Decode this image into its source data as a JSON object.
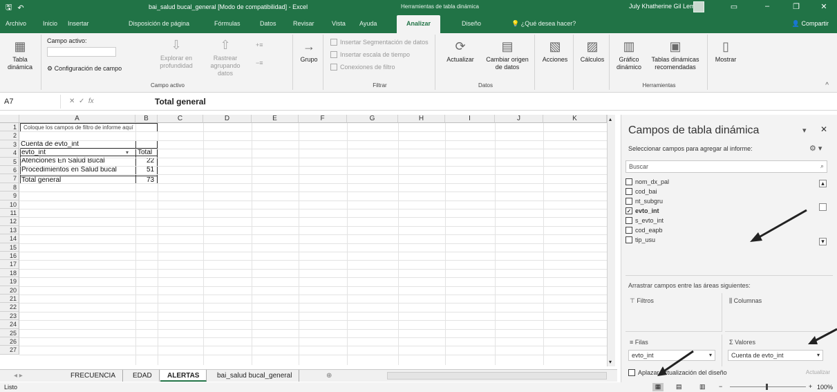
{
  "window": {
    "title": "bai_salud bucal_general  [Modo de compatibilidad]  -  Excel",
    "tools_label": "Herramientas de tabla dinámica",
    "user": "July Khatherine Gil Lemus"
  },
  "tabs": [
    "Archivo",
    "Inicio",
    "Insertar",
    "Disposición de página",
    "Fórmulas",
    "Datos",
    "Revisar",
    "Vista",
    "Ayuda",
    "Analizar",
    "Diseño"
  ],
  "tell_me": "¿Qué desea hacer?",
  "share": "Compartir",
  "ribbon": {
    "tabla_label": "Tabla\ndinámica",
    "campo_activo_label": "Campo activo:",
    "config_campo": "Configuración de campo",
    "explorar": "Explorar en\nprofundidad",
    "rastrear": "Rastrear agrupando\ndatos",
    "campo_activo_group": "Campo activo",
    "grupo": "Grupo",
    "insertar_seg": "Insertar Segmentación de datos",
    "insertar_escala": "Insertar escala de tiempo",
    "conexiones": "Conexiones de filtro",
    "filtrar_group": "Filtrar",
    "actualizar": "Actualizar",
    "cambiar_origen": "Cambiar origen\nde datos",
    "datos_group": "Datos",
    "acciones": "Acciones",
    "calculos": "Cálculos",
    "grafico": "Gráfico\ndinámico",
    "tablas_rec": "Tablas dinámicas\nrecomendadas",
    "herramientas_group": "Herramientas",
    "mostrar": "Mostrar"
  },
  "formula_bar": {
    "name_box": "A7",
    "content": "Total general"
  },
  "columns": [
    "A",
    "B",
    "C",
    "D",
    "E",
    "F",
    "G",
    "H",
    "I",
    "J",
    "K"
  ],
  "rows": [
    "1",
    "2",
    "3",
    "4",
    "5",
    "6",
    "7",
    "8",
    "9",
    "10",
    "11",
    "12",
    "13",
    "14",
    "15",
    "16",
    "17",
    "18",
    "19",
    "20",
    "21",
    "22",
    "23",
    "24",
    "25",
    "26",
    "27"
  ],
  "pivot": {
    "filter_hint": "Coloque los campos de filtro de informe aquí",
    "title": "Cuenta de evto_int",
    "row_header": "evto_int",
    "col_header": "Total",
    "rows": [
      {
        "label": "Atenciones En Salud Bucal",
        "value": "22"
      },
      {
        "label": "Procedimientos en Salud bucal",
        "value": "51"
      }
    ],
    "total_label": "Total general",
    "total_value": "73"
  },
  "sheets": [
    "FRECUENCIA",
    "EDAD",
    "ALERTAS",
    "bai_salud bucal_general"
  ],
  "active_sheet": "ALERTAS",
  "status": {
    "ready": "Listo",
    "zoom": "100%"
  },
  "pane": {
    "title": "Campos de tabla dinámica",
    "subtitle": "Seleccionar campos para agregar al informe:",
    "search_placeholder": "Buscar",
    "fields": [
      {
        "name": "nom_dx_pal",
        "checked": false
      },
      {
        "name": "cod_bai",
        "checked": false
      },
      {
        "name": "nt_subgru",
        "checked": false
      },
      {
        "name": "evto_int",
        "checked": true
      },
      {
        "name": "s_evto_int",
        "checked": false
      },
      {
        "name": "cod_eapb",
        "checked": false
      },
      {
        "name": "tip_usu",
        "checked": false
      }
    ],
    "drag_label": "Arrastrar campos entre las áreas siguientes:",
    "filtros": "Filtros",
    "columnas": "Columnas",
    "filas": "Filas",
    "valores": "Valores",
    "filas_item": "evto_int",
    "valores_item": "Cuenta de evto_int",
    "defer": "Aplazar actualización del diseño",
    "update": "Actualizar"
  }
}
